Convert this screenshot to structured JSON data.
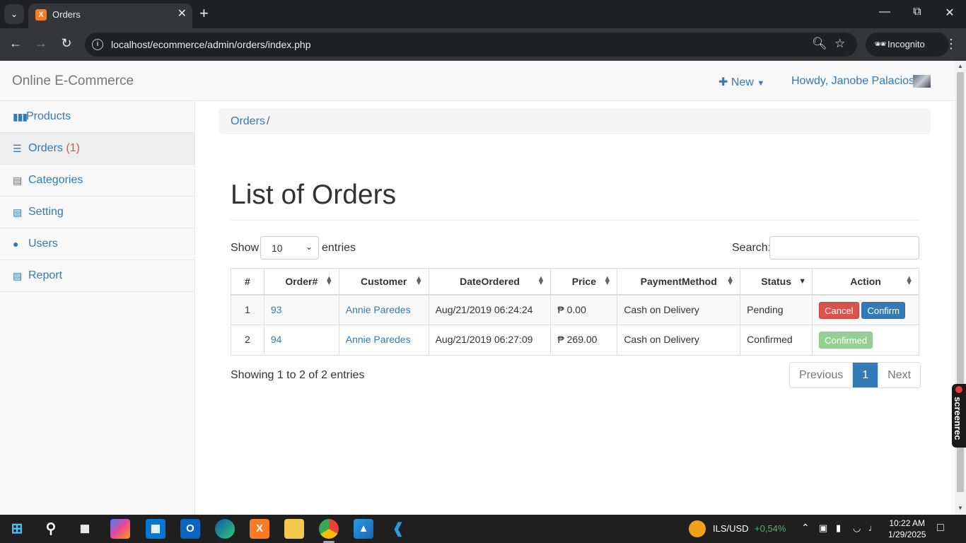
{
  "browser": {
    "tab_title": "Orders",
    "tab_favicon": "X",
    "url": "localhost/ecommerce/admin/orders/index.php",
    "incognito_label": "Incognito"
  },
  "navbar": {
    "brand": "Online E-Commerce",
    "new_label": "New",
    "user_label": "Howdy, Janobe Palacios"
  },
  "sidebar": {
    "items": [
      {
        "label": "Products",
        "icon": "barcode-icon"
      },
      {
        "label": "Orders",
        "badge": "(1)",
        "icon": "list-icon"
      },
      {
        "label": "Categories",
        "icon": "list-alt-icon"
      },
      {
        "label": "Setting",
        "icon": "list-alt-icon"
      },
      {
        "label": "Users",
        "icon": "user-icon"
      },
      {
        "label": "Report",
        "icon": "file-icon"
      }
    ]
  },
  "breadcrumb": {
    "current": "Orders",
    "separator": "/"
  },
  "main": {
    "title": "List of Orders",
    "show_label": "Show",
    "page_size": "10",
    "entries_label": "entries",
    "search_label": "Search:",
    "search_value": ""
  },
  "table": {
    "headers": [
      "#",
      "Order#",
      "Customer",
      "DateOrdered",
      "Price",
      "PaymentMethod",
      "Status",
      "Action"
    ],
    "rows": [
      {
        "num": "1",
        "order": "93",
        "customer": "Annie Paredes",
        "date": "Aug/21/2019 06:24:24",
        "price": "₱ 0.00",
        "payment": "Cash on Delivery",
        "status": "Pending",
        "actions": [
          "Cancel",
          "Confirm"
        ]
      },
      {
        "num": "2",
        "order": "94",
        "customer": "Annie Paredes",
        "date": "Aug/21/2019 06:27:09",
        "price": "₱ 269.00",
        "payment": "Cash on Delivery",
        "status": "Confirmed",
        "actions": [
          "Confirmed"
        ]
      }
    ]
  },
  "footer": {
    "showing": "Showing 1 to 2 of 2 entries",
    "prev": "Previous",
    "page": "1",
    "next": "Next"
  },
  "screenrec_label": "screenrec",
  "taskbar": {
    "ticker": "ILS/USD",
    "ticker_change": "+0,54%",
    "time": "10:22 AM",
    "date": "1/29/2025"
  },
  "colors": {
    "link": "#337ab7",
    "danger": "#d9534f",
    "success": "#5cb85c"
  }
}
